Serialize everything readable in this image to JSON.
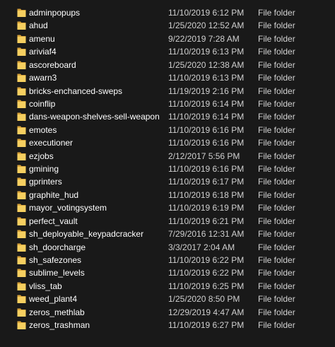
{
  "colors": {
    "background": "#191919",
    "folder_back": "#d9a43a",
    "folder_front": "#f6cf60",
    "text_primary": "#ffffff",
    "text_secondary": "#d0d0d0"
  },
  "files": [
    {
      "name": "adminpopups",
      "date": "11/10/2019 6:12 PM",
      "type": "File folder",
      "icon": "folder-icon"
    },
    {
      "name": "ahud",
      "date": "1/25/2020 12:52 AM",
      "type": "File folder",
      "icon": "folder-icon"
    },
    {
      "name": "amenu",
      "date": "9/22/2019 7:28 AM",
      "type": "File folder",
      "icon": "folder-icon"
    },
    {
      "name": "ariviaf4",
      "date": "11/10/2019 6:13 PM",
      "type": "File folder",
      "icon": "folder-icon"
    },
    {
      "name": "ascoreboard",
      "date": "1/25/2020 12:38 AM",
      "type": "File folder",
      "icon": "folder-icon"
    },
    {
      "name": "awarn3",
      "date": "11/10/2019 6:13 PM",
      "type": "File folder",
      "icon": "folder-icon"
    },
    {
      "name": "bricks-enchanced-sweps",
      "date": "11/19/2019 2:16 PM",
      "type": "File folder",
      "icon": "folder-icon"
    },
    {
      "name": "coinflip",
      "date": "11/10/2019 6:14 PM",
      "type": "File folder",
      "icon": "folder-icon"
    },
    {
      "name": "dans-weapon-shelves-sell-weapons-t...",
      "date": "11/10/2019 6:14 PM",
      "type": "File folder",
      "icon": "folder-icon"
    },
    {
      "name": "emotes",
      "date": "11/10/2019 6:16 PM",
      "type": "File folder",
      "icon": "folder-icon"
    },
    {
      "name": "executioner",
      "date": "11/10/2019 6:16 PM",
      "type": "File folder",
      "icon": "folder-icon"
    },
    {
      "name": "ezjobs",
      "date": "2/12/2017 5:56 PM",
      "type": "File folder",
      "icon": "folder-icon"
    },
    {
      "name": "gmining",
      "date": "11/10/2019 6:16 PM",
      "type": "File folder",
      "icon": "folder-icon"
    },
    {
      "name": "gprinters",
      "date": "11/10/2019 6:17 PM",
      "type": "File folder",
      "icon": "folder-icon"
    },
    {
      "name": "graphite_hud",
      "date": "11/10/2019 6:18 PM",
      "type": "File folder",
      "icon": "folder-icon"
    },
    {
      "name": "mayor_votingsystem",
      "date": "11/10/2019 6:19 PM",
      "type": "File folder",
      "icon": "folder-icon"
    },
    {
      "name": "perfect_vault",
      "date": "11/10/2019 6:21 PM",
      "type": "File folder",
      "icon": "folder-icon"
    },
    {
      "name": "sh_deployable_keypadcracker",
      "date": "7/29/2016 12:31 AM",
      "type": "File folder",
      "icon": "folder-icon"
    },
    {
      "name": "sh_doorcharge",
      "date": "3/3/2017 2:04 AM",
      "type": "File folder",
      "icon": "folder-icon"
    },
    {
      "name": "sh_safezones",
      "date": "11/10/2019 6:22 PM",
      "type": "File folder",
      "icon": "folder-icon"
    },
    {
      "name": "sublime_levels",
      "date": "11/10/2019 6:22 PM",
      "type": "File folder",
      "icon": "folder-icon"
    },
    {
      "name": "vliss_tab",
      "date": "11/10/2019 6:25 PM",
      "type": "File folder",
      "icon": "folder-icon"
    },
    {
      "name": "weed_plant4",
      "date": "1/25/2020 8:50 PM",
      "type": "File folder",
      "icon": "folder-icon"
    },
    {
      "name": "zeros_methlab",
      "date": "12/29/2019 4:47 AM",
      "type": "File folder",
      "icon": "folder-icon"
    },
    {
      "name": "zeros_trashman",
      "date": "11/10/2019 6:27 PM",
      "type": "File folder",
      "icon": "folder-icon"
    }
  ]
}
